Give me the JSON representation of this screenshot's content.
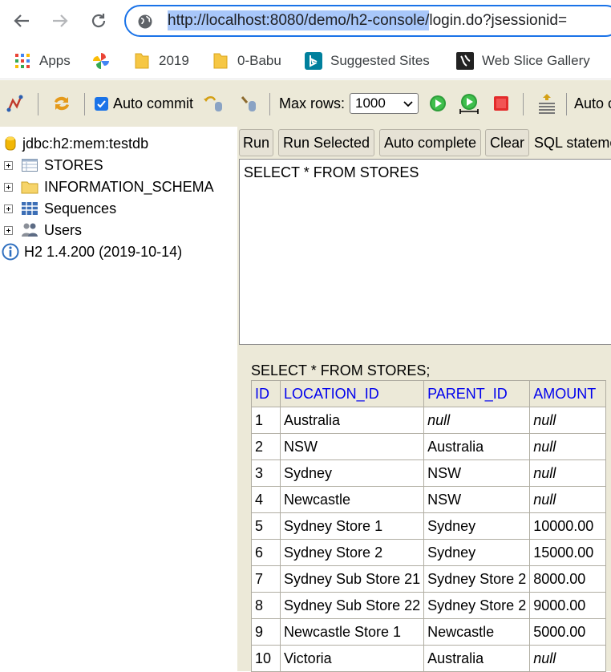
{
  "browser": {
    "url_selected": "http://localhost:8080/demo/h2-console/",
    "url_rest": "login.do?jsessionid=",
    "nav": [
      "back-icon",
      "forward-icon",
      "reload-icon"
    ],
    "bookmarks": [
      {
        "label": "Apps",
        "icon": "apps-grid-icon"
      },
      {
        "label": "",
        "icon": "pinwheel-icon"
      },
      {
        "label": "2019",
        "icon": "folder-icon"
      },
      {
        "label": "0-Babu",
        "icon": "folder-icon"
      },
      {
        "label": "Suggested Sites",
        "icon": "bing-icon"
      },
      {
        "label": "Web Slice Gallery",
        "icon": "web-slice-icon"
      }
    ]
  },
  "toolbar": {
    "auto_commit_label": "Auto commit",
    "auto_commit_checked": true,
    "max_rows_label": "Max rows:",
    "max_rows_value": "1000",
    "auto_label": "Auto c"
  },
  "tree": {
    "connection": "jdbc:h2:mem:testdb",
    "items": [
      "STORES",
      "INFORMATION_SCHEMA",
      "Sequences",
      "Users"
    ],
    "version": "H2 1.4.200 (2019-10-14)"
  },
  "query": {
    "buttons": [
      "Run",
      "Run Selected",
      "Auto complete",
      "Clear"
    ],
    "sql_label": "SQL stateme",
    "sql_text": "SELECT * FROM STORES"
  },
  "result": {
    "title": "SELECT * FROM STORES;",
    "columns": [
      "ID",
      "LOCATION_ID",
      "PARENT_ID",
      "AMOUNT"
    ],
    "rows": [
      [
        "1",
        "Australia",
        "null",
        "null"
      ],
      [
        "2",
        "NSW",
        "Australia",
        "null"
      ],
      [
        "3",
        "Sydney",
        "NSW",
        "null"
      ],
      [
        "4",
        "Newcastle",
        "NSW",
        "null"
      ],
      [
        "5",
        "Sydney Store 1",
        "Sydney",
        "10000.00"
      ],
      [
        "6",
        "Sydney Store 2",
        "Sydney",
        "15000.00"
      ],
      [
        "7",
        "Sydney Sub Store 21",
        "Sydney Store 2",
        "8000.00"
      ],
      [
        "8",
        "Sydney Sub Store 22",
        "Sydney Store 2",
        "9000.00"
      ],
      [
        "9",
        "Newcastle Store 1",
        "Newcastle",
        "5000.00"
      ],
      [
        "10",
        "Victoria",
        "Australia",
        "null"
      ]
    ]
  },
  "colors": {
    "toolbar_bg": "#ece9d8",
    "link_blue": "#0000ee",
    "focus_blue": "#1a73e8"
  }
}
